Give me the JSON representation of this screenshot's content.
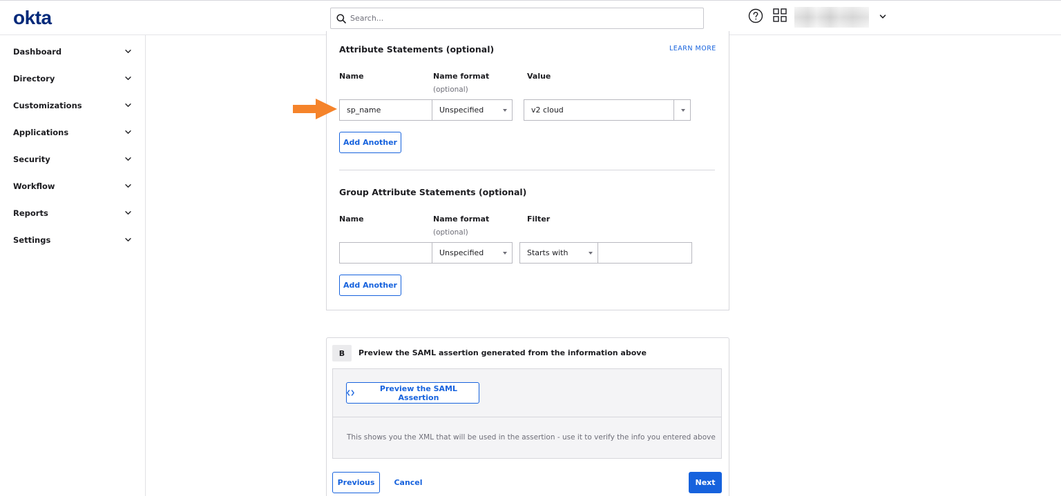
{
  "header": {
    "logo": "okta",
    "search_placeholder": "Search...",
    "help_icon": "help-circle-icon",
    "apps_icon": "apps-grid-icon"
  },
  "sidebar": {
    "items": [
      {
        "label": "Dashboard"
      },
      {
        "label": "Directory"
      },
      {
        "label": "Customizations"
      },
      {
        "label": "Applications"
      },
      {
        "label": "Security"
      },
      {
        "label": "Workflow"
      },
      {
        "label": "Reports"
      },
      {
        "label": "Settings"
      }
    ]
  },
  "attribute_statements": {
    "title": "Attribute Statements (optional)",
    "learn_more": "LEARN MORE",
    "col_name": "Name",
    "col_name_format": "Name format",
    "col_name_format_sub": "(optional)",
    "col_value": "Value",
    "row": {
      "name": "sp_name",
      "name_format": "Unspecified",
      "value": "v2 cloud"
    },
    "add_another": "Add Another"
  },
  "group_attribute_statements": {
    "title": "Group Attribute Statements (optional)",
    "col_name": "Name",
    "col_name_format": "Name format",
    "col_name_format_sub": "(optional)",
    "col_filter": "Filter",
    "row": {
      "name": "",
      "name_format": "Unspecified",
      "filter_type": "Starts with",
      "filter_value": ""
    },
    "add_another": "Add Another"
  },
  "preview": {
    "badge": "B",
    "title": "Preview the SAML assertion generated from the information above",
    "button_label": "Preview the SAML Assertion",
    "note": "This shows you the XML that will be used in the assertion - use it to verify the info you entered above"
  },
  "footer": {
    "previous": "Previous",
    "cancel": "Cancel",
    "next": "Next"
  },
  "colors": {
    "brand": "#00297a",
    "accent": "#1662dd",
    "arrow": "#f5832a"
  }
}
